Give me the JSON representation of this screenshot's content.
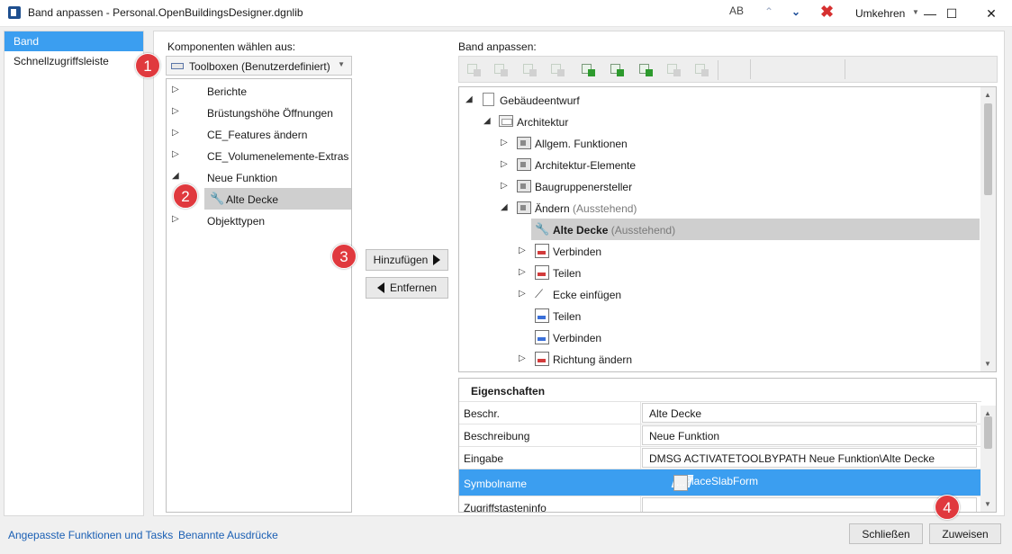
{
  "window": {
    "title": "Band anpassen - Personal.OpenBuildingsDesigner.dgnlib",
    "minimize": "—",
    "maximize": "☐",
    "close": "✕"
  },
  "nav": {
    "items": [
      {
        "label": "Band",
        "selected": true
      },
      {
        "label": "Schnellzugriffsleiste",
        "selected": false
      }
    ]
  },
  "left": {
    "label": "Komponenten wählen aus:",
    "combo_value": "Toolboxen (Benutzerdefiniert)",
    "items": [
      {
        "label": "Berichte",
        "expander": "▷"
      },
      {
        "label": "Brüstungshöhe Öffnungen",
        "expander": "▷"
      },
      {
        "label": "CE_Features ändern",
        "expander": "▷"
      },
      {
        "label": "CE_Volumenelemente-Extras",
        "expander": "▷"
      },
      {
        "label": "Neue Funktion",
        "expander": "◢"
      },
      {
        "label": "Objekttypen",
        "expander": "▷"
      }
    ],
    "child": {
      "label": "Alte Decke",
      "icon": "wrench-icon",
      "glyph": "🔧"
    }
  },
  "center": {
    "add_label": "Hinzufügen",
    "remove_label": "Entfernen"
  },
  "right": {
    "label": "Band anpassen:",
    "toolbar": {
      "aa": "AB",
      "up": "⌃",
      "down": "⌄",
      "delete": "✖",
      "umkehren": "Umkehren",
      "dropdown": "▼"
    },
    "tree": [
      {
        "label": "Gebäudeentwurf",
        "pending": "",
        "expander": "◢",
        "icon": "page-icon"
      },
      {
        "label": "Architektur",
        "pending": "",
        "expander": "◢",
        "icon": "tab-icon"
      },
      {
        "label": "Allgem. Funktionen",
        "pending": "",
        "expander": "▷",
        "icon": "group-icon"
      },
      {
        "label": "Architektur-Elemente",
        "pending": "",
        "expander": "▷",
        "icon": "group-icon"
      },
      {
        "label": "Baugruppenersteller",
        "pending": "",
        "expander": "▷",
        "icon": "group-icon"
      },
      {
        "label": "Ändern",
        "pending": "(Ausstehend)",
        "expander": "◢",
        "icon": "group-icon"
      },
      {
        "label": "Alte Decke",
        "pending": "(Ausstehend)",
        "expander": "",
        "icon": "wrench-icon"
      },
      {
        "label": "Verbinden",
        "pending": "",
        "expander": "▷",
        "icon": "tool-icon"
      },
      {
        "label": "Teilen",
        "pending": "",
        "expander": "▷",
        "icon": "tool-icon"
      },
      {
        "label": "Ecke einfügen",
        "pending": "",
        "expander": "▷",
        "icon": "corner-icon"
      },
      {
        "label": "Teilen",
        "pending": "",
        "expander": "",
        "icon": "tool-icon"
      },
      {
        "label": "Verbinden",
        "pending": "",
        "expander": "",
        "icon": "tool-icon"
      },
      {
        "label": "Richtung ändern",
        "pending": "",
        "expander": "▷",
        "icon": "tool-icon"
      }
    ],
    "scroll": {
      "up": "▲",
      "down": "▼"
    }
  },
  "properties": {
    "title": "Eigenschaften",
    "rows": [
      {
        "name": "Beschr.",
        "value": "Alte Decke"
      },
      {
        "name": "Beschreibung",
        "value": "Neue Funktion"
      },
      {
        "name": "Eingabe",
        "value": "DMSG ACTIVATETOOLBYPATH Neue Funktion\\Alte Decke"
      },
      {
        "name": "Symbolname",
        "value": "A-PlaceSlabForm",
        "selected": true,
        "ellipsis": "..."
      },
      {
        "name": "Zugriffstasteninfo",
        "value": ""
      }
    ]
  },
  "footer": {
    "link1": "Angepasste Funktionen und Tasks",
    "link2": "Benannte Ausdrücke",
    "close": "Schließen",
    "apply": "Zuweisen"
  },
  "badges": [
    "1",
    "2",
    "3",
    "4"
  ],
  "colors": {
    "accent": "#3b9ef0",
    "badge": "#e0393e",
    "link": "#1a5fb4"
  }
}
